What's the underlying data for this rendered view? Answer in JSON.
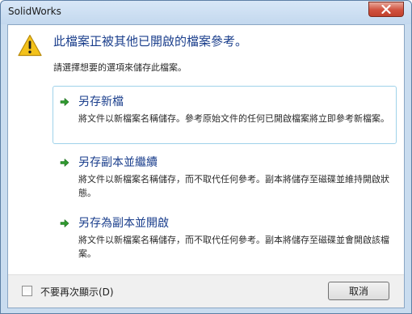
{
  "window": {
    "title": "SolidWorks"
  },
  "icons": {
    "warning": "warning-triangle-icon",
    "option_arrow": "green-arrow-icon",
    "close": "close-x-icon"
  },
  "colors": {
    "heading_blue": "#1a3e8c",
    "arrow_green": "#2f9a2f",
    "warning_yellow": "#f3c21b",
    "close_red": "#c8452f",
    "hover_border": "#9fd2ea"
  },
  "dialog": {
    "headline": "此檔案正被其他已開啟的檔案參考。",
    "instruction": "請選擇想要的選項來儲存此檔案。",
    "options": [
      {
        "title": "另存新檔",
        "description": "將文件以新檔案名稱儲存。參考原始文件的任何已開啟檔案將立即參考新檔案。"
      },
      {
        "title": "另存副本並繼續",
        "description": "將文件以新檔案名稱儲存，而不取代任何參考。副本將儲存至磁碟並維持開啟狀態。"
      },
      {
        "title": "另存為副本並開啟",
        "description": "將文件以新檔案名稱儲存，而不取代任何參考。副本將儲存至磁碟並會開啟該檔案。"
      }
    ],
    "dont_show_again_label": "不要再次顯示(D)",
    "cancel_label": "取消"
  }
}
